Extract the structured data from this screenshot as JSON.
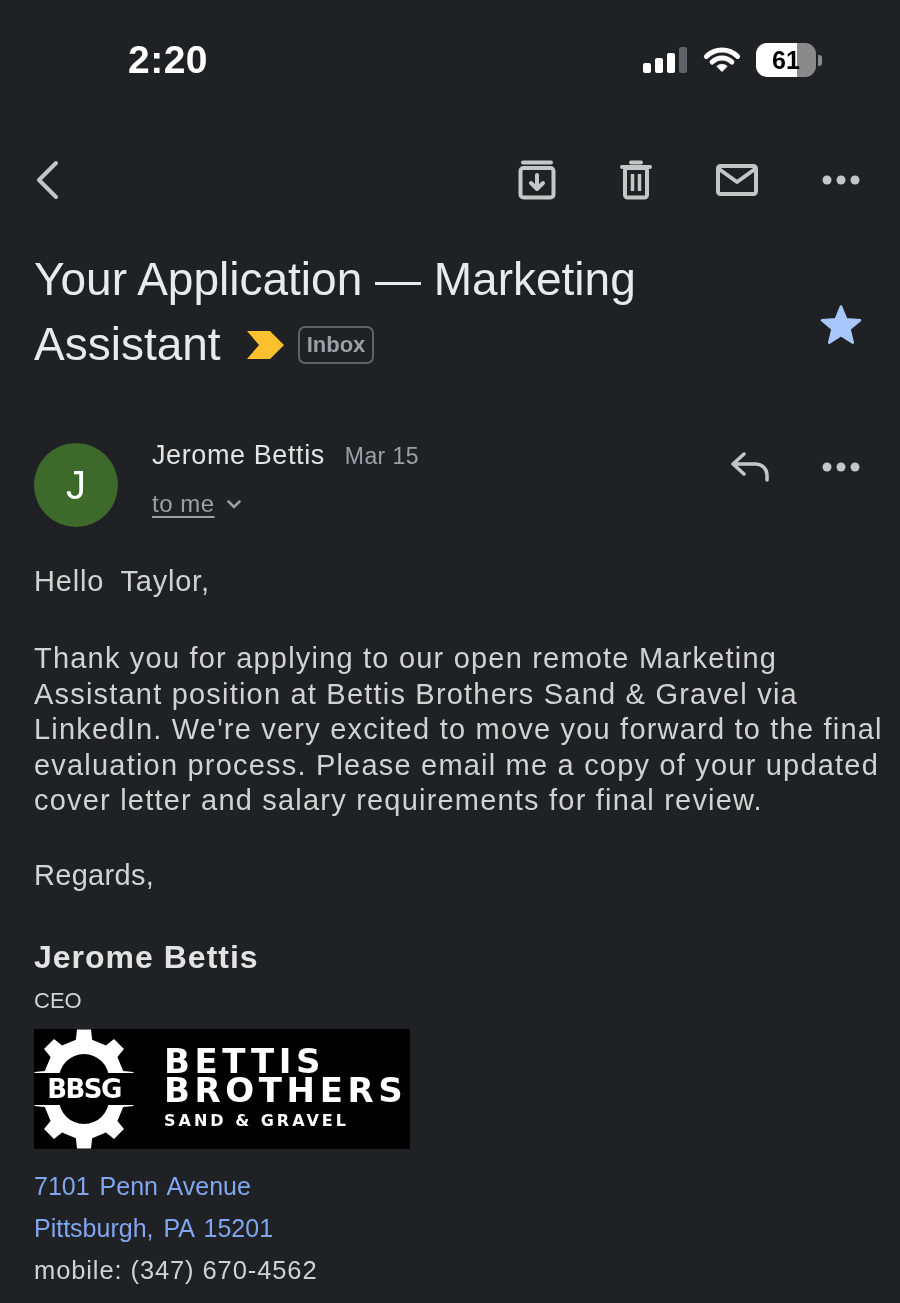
{
  "status_bar": {
    "time": "2:20",
    "battery": "61"
  },
  "subject": {
    "title_lines": [
      "Your Application — Marketing",
      "Assistant"
    ],
    "important": true,
    "label": "Inbox",
    "starred": true
  },
  "message": {
    "sender": "Jerome Bettis",
    "avatar_letter": "J",
    "date": "Mar 15",
    "recipient": "to me"
  },
  "body": {
    "greeting": "Hello Taylor,",
    "paragraph": "Thank you for applying to our open remote Marketing Assistant position at Bettis Brothers Sand & Gravel via LinkedIn. We're very excited to move you forward to the final evaluation process. Please email me a copy of your updated cover letter and salary requirements for final review.",
    "closing": "Regards,"
  },
  "signature": {
    "name": "Jerome Bettis",
    "title": "CEO",
    "logo": {
      "monogram": "BBSG",
      "name_lines": [
        "BETTIS",
        "BROTHERS"
      ],
      "tagline": "SAND & GRAVEL"
    },
    "address_links": [
      "7101 Penn Avenue",
      "Pittsburgh, PA 15201"
    ],
    "phone": "mobile: (347) 670-4562"
  }
}
